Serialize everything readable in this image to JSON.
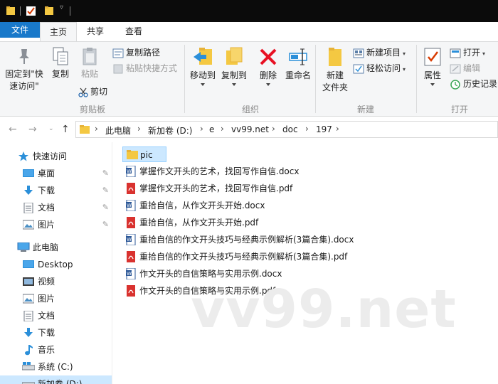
{
  "ribbon_tabs": {
    "file": "文件",
    "home": "主页",
    "share": "共享",
    "view": "查看"
  },
  "ribbon": {
    "clipboard": {
      "pin_quick_access": [
        "固定到\"快",
        "速访问\""
      ],
      "copy": "复制",
      "paste": "粘贴",
      "copy_path": "复制路径",
      "paste_shortcut": "粘贴快捷方式",
      "cut": "剪切",
      "group_label": "剪贴板"
    },
    "organize": {
      "move_to": "移动到",
      "copy_to": "复制到",
      "delete": "删除",
      "rename": "重命名",
      "group_label": "组织"
    },
    "new": {
      "new_folder": [
        "新建",
        "文件夹"
      ],
      "new_item": "新建项目",
      "easy_access": "轻松访问",
      "group_label": "新建"
    },
    "open": {
      "properties": "属性",
      "open": "打开",
      "edit": "编辑",
      "history": "历史记录",
      "group_label": "打开"
    }
  },
  "address": {
    "crumbs": [
      "此电脑",
      "新加卷 (D:)",
      "e",
      "vv99.net",
      "doc",
      "197"
    ]
  },
  "sidebar": {
    "items": [
      {
        "label": "快速访问",
        "icon": "star-icon",
        "pinned": false
      },
      {
        "label": "桌面",
        "icon": "desktop-icon",
        "pinned": true
      },
      {
        "label": "下载",
        "icon": "download-icon",
        "pinned": true
      },
      {
        "label": "文档",
        "icon": "document-icon",
        "pinned": true
      },
      {
        "label": "图片",
        "icon": "picture-icon",
        "pinned": true
      },
      {
        "label": "此电脑",
        "icon": "computer-icon",
        "pinned": false
      },
      {
        "label": "Desktop",
        "icon": "desktop-icon",
        "pinned": false
      },
      {
        "label": "视频",
        "icon": "video-icon",
        "pinned": false
      },
      {
        "label": "图片",
        "icon": "picture-icon",
        "pinned": false
      },
      {
        "label": "文档",
        "icon": "document-icon",
        "pinned": false
      },
      {
        "label": "下载",
        "icon": "download-icon",
        "pinned": false
      },
      {
        "label": "音乐",
        "icon": "music-icon",
        "pinned": false
      },
      {
        "label": "系统 (C:)",
        "icon": "drive-icon",
        "pinned": false
      },
      {
        "label": "新加卷 (D:)",
        "icon": "drive-icon",
        "pinned": false
      }
    ]
  },
  "files": [
    {
      "name": "pic",
      "type": "folder"
    },
    {
      "name": "掌握作文开头的艺术，找回写作自信.docx",
      "type": "docx"
    },
    {
      "name": "掌握作文开头的艺术，找回写作自信.pdf",
      "type": "pdf"
    },
    {
      "name": "重拾自信，从作文开头开始.docx",
      "type": "docx"
    },
    {
      "name": "重拾自信，从作文开头开始.pdf",
      "type": "pdf"
    },
    {
      "name": "重拾自信的作文开头技巧与经典示例解析(3篇合集).docx",
      "type": "docx"
    },
    {
      "name": "重拾自信的作文开头技巧与经典示例解析(3篇合集).pdf",
      "type": "pdf"
    },
    {
      "name": "作文开头的自信策略与实用示例.docx",
      "type": "docx"
    },
    {
      "name": "作文开头的自信策略与实用示例.pdf",
      "type": "pdf"
    }
  ],
  "watermark": "vv99.net",
  "colors": {
    "file_tab": "#1979ca",
    "selection": "#cce8ff",
    "folder": "#f4c842",
    "word": "#2b5797",
    "pdf": "#d9322f",
    "delete_red": "#e81123"
  }
}
